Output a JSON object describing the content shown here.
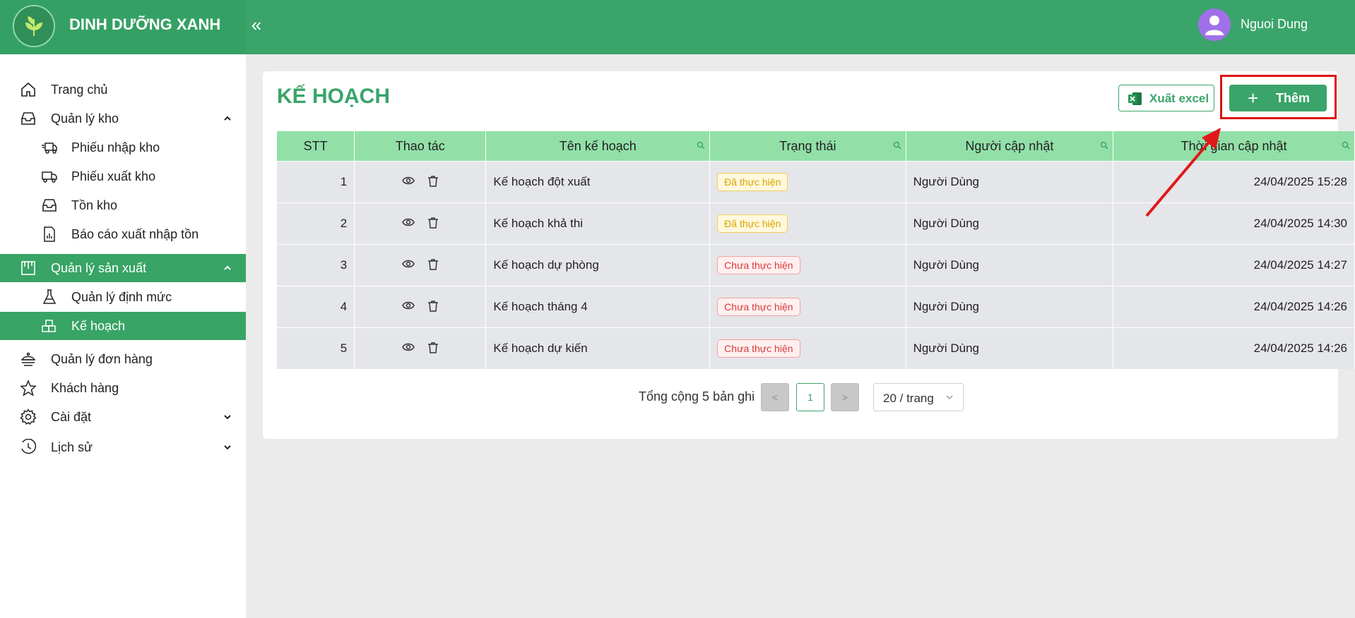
{
  "header": {
    "brand": "DINH DƯỠNG XANH",
    "collapse_icon": "«",
    "user_name": "Nguoi Dung"
  },
  "sidebar": {
    "items": [
      {
        "label": "Trang chủ",
        "icon": "home-icon"
      },
      {
        "label": "Quản lý kho",
        "icon": "inbox-icon"
      },
      {
        "label": "Phiếu nhập kho",
        "icon": "truck-in-icon"
      },
      {
        "label": "Phiếu xuất kho",
        "icon": "truck-out-icon"
      },
      {
        "label": "Tồn kho",
        "icon": "inbox-icon"
      },
      {
        "label": "Báo cáo xuất nhập tồn",
        "icon": "report-icon"
      },
      {
        "label": "Quản lý sản xuất",
        "icon": "factory-icon"
      },
      {
        "label": "Quản lý định mức",
        "icon": "flask-icon"
      },
      {
        "label": "Kế hoạch",
        "icon": "blocks-icon"
      },
      {
        "label": "Quản lý đơn hàng",
        "icon": "order-icon"
      },
      {
        "label": "Khách hàng",
        "icon": "star-icon"
      },
      {
        "label": "Cài đặt",
        "icon": "gear-icon"
      },
      {
        "label": "Lịch sử",
        "icon": "history-icon"
      }
    ]
  },
  "main": {
    "title": "KẾ HOẠCH",
    "export_label": "Xuất excel",
    "add_label": "Thêm",
    "columns": [
      "STT",
      "Thao tác",
      "Tên kế hoạch",
      "Trạng thái",
      "Người cập nhật",
      "Thời gian cập nhật"
    ],
    "rows": [
      {
        "stt": "1",
        "name": "Kế hoạch đột xuất",
        "status": "Đã thực hiện",
        "user": "Người Dùng",
        "time": "24/04/2025 15:28"
      },
      {
        "stt": "2",
        "name": "Kế hoạch khả thi",
        "status": "Đã thực hiện",
        "user": "Người Dùng",
        "time": "24/04/2025 14:30"
      },
      {
        "stt": "3",
        "name": "Kế hoạch dự phòng",
        "status": "Chưa thực hiện",
        "user": "Người Dùng",
        "time": "24/04/2025 14:27"
      },
      {
        "stt": "4",
        "name": "Kế hoạch tháng 4",
        "status": "Chưa thực hiện",
        "user": "Người Dùng",
        "time": "24/04/2025 14:26"
      },
      {
        "stt": "5",
        "name": "Kế hoạch dự kiến",
        "status": "Chưa thực hiện",
        "user": "Người Dùng",
        "time": "24/04/2025 14:26"
      }
    ],
    "pagination": {
      "total_text": "Tổng cộng 5 bản ghi",
      "prev": "<",
      "current": "1",
      "next": ">",
      "page_size": "20 / trang"
    }
  },
  "colors": {
    "brand_green": "#3aa46a",
    "header_green": "#92e0a8",
    "highlight_red": "#e01010"
  }
}
